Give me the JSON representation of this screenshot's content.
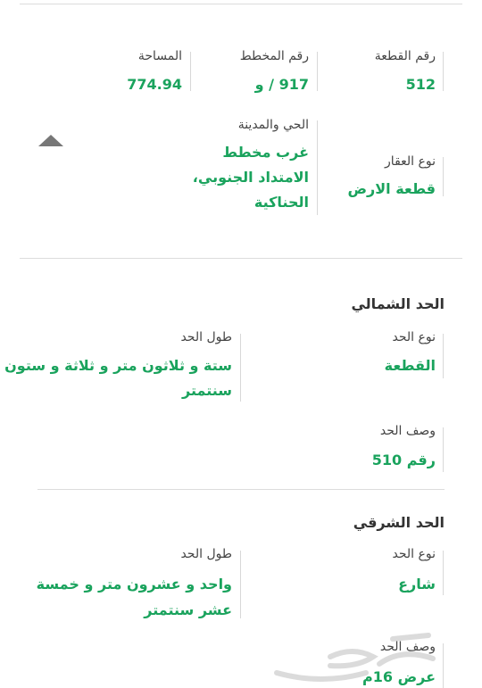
{
  "property": {
    "plot_number": {
      "label": "رقم القطعة",
      "value": "512"
    },
    "plan_number": {
      "label": "رقم المخطط",
      "value": "917 / و"
    },
    "area": {
      "label": "المساحة",
      "value": "774.94"
    },
    "property_type": {
      "label": "نوع العقار",
      "value": "قطعة الارض"
    },
    "district_city": {
      "label": "الحي والمدينة",
      "value_lines": [
        "غرب مخطط",
        "الامتداد الجنوبي،",
        "الحناكية"
      ]
    }
  },
  "north_boundary": {
    "title": "الحد الشمالي",
    "type": {
      "label": "نوع الحد",
      "value": "القطعة"
    },
    "length": {
      "label": "طول الحد",
      "value_lines": [
        "ستة و ثلاثون متر و ثلاثة و ستون",
        "سنتمتر"
      ]
    },
    "description": {
      "label": "وصف الحد",
      "value": "رقم 510"
    }
  },
  "east_boundary": {
    "title": "الحد الشرقي",
    "type": {
      "label": "نوع الحد",
      "value": "شارع"
    },
    "length": {
      "label": "طول الحد",
      "value_lines": [
        "واحد و عشرون متر و خمسة",
        "عشر سنتمتر"
      ]
    },
    "description": {
      "label": "وصف الحد",
      "value": "عرض 16م"
    }
  },
  "icons": {
    "collapse": "triangle-up-icon",
    "watermark": "haraj-logo-watermark"
  },
  "colors": {
    "accent_green": "#1aa35d",
    "divider": "#dcdcdc",
    "label": "#444444",
    "icon": "#777777"
  }
}
